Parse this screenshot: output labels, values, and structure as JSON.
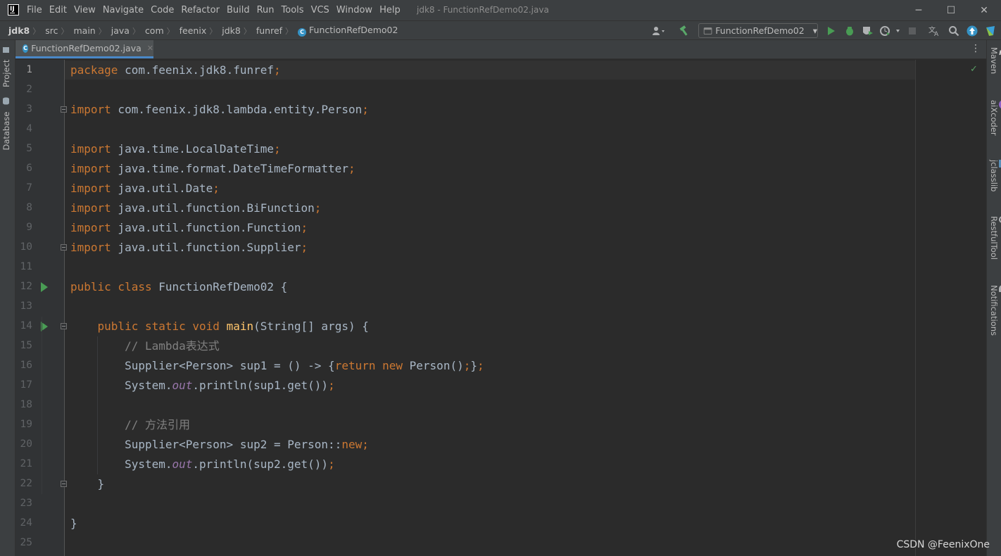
{
  "titlebar": {
    "logo_text": "IJ",
    "menu": [
      "File",
      "Edit",
      "View",
      "Navigate",
      "Code",
      "Refactor",
      "Build",
      "Run",
      "Tools",
      "VCS",
      "Window",
      "Help"
    ],
    "window_title": "jdk8 - FunctionRefDemo02.java",
    "minimize_glyph": "─",
    "maximize_glyph": "☐",
    "close_glyph": "✕"
  },
  "breadcrumb": [
    "jdk8",
    "src",
    "main",
    "java",
    "com",
    "feenix",
    "jdk8",
    "funref",
    "FunctionRefDemo02"
  ],
  "breadcrumb_sep": "〉",
  "toolbar": {
    "run_config": "FunctionRefDemo02",
    "dropdown_glyph": "▾",
    "icons": [
      "user-icon",
      "hammer-icon",
      "run-config-icon",
      "run-icon",
      "debug-icon",
      "coverage-icon",
      "profile-icon",
      "stop-icon",
      "translate-icon",
      "search-icon",
      "update-icon",
      "plugin-icon"
    ]
  },
  "left_tool_windows": [
    "Project",
    "Database"
  ],
  "right_tool_windows": [
    "Maven",
    "aiXcoder",
    "jclasslib",
    "RestfulTool",
    "Notifications"
  ],
  "editor_tab": {
    "label": "FunctionRefDemo02.java",
    "close_glyph": "✕",
    "icon_letter": "C"
  },
  "editor": {
    "line_numbers": [
      "1",
      "2",
      "3",
      "4",
      "5",
      "6",
      "7",
      "8",
      "9",
      "10",
      "11",
      "12",
      "13",
      "14",
      "15",
      "16",
      "17",
      "18",
      "19",
      "20",
      "21",
      "22",
      "23",
      "24",
      "25"
    ],
    "current_line": 1,
    "run_gutter_lines": [
      12,
      14
    ],
    "fold_lines": [
      3,
      10,
      14,
      22
    ],
    "code": [
      [
        [
          "kw",
          "package"
        ],
        [
          "t",
          " com.feenix.jdk8.funref"
        ],
        [
          "kw",
          ";"
        ]
      ],
      [],
      [
        [
          "kw",
          "import"
        ],
        [
          "t",
          " com.feenix.jdk8.lambda.entity.Person"
        ],
        [
          "kw",
          ";"
        ]
      ],
      [],
      [
        [
          "kw",
          "import"
        ],
        [
          "t",
          " java.time.LocalDateTime"
        ],
        [
          "kw",
          ";"
        ]
      ],
      [
        [
          "kw",
          "import"
        ],
        [
          "t",
          " java.time.format.DateTimeFormatter"
        ],
        [
          "kw",
          ";"
        ]
      ],
      [
        [
          "kw",
          "import"
        ],
        [
          "t",
          " java.util.Date"
        ],
        [
          "kw",
          ";"
        ]
      ],
      [
        [
          "kw",
          "import"
        ],
        [
          "t",
          " java.util.function.BiFunction"
        ],
        [
          "kw",
          ";"
        ]
      ],
      [
        [
          "kw",
          "import"
        ],
        [
          "t",
          " java.util.function.Function"
        ],
        [
          "kw",
          ";"
        ]
      ],
      [
        [
          "kw",
          "import"
        ],
        [
          "t",
          " java.util.function.Supplier"
        ],
        [
          "kw",
          ";"
        ]
      ],
      [],
      [
        [
          "kw",
          "public class"
        ],
        [
          "t",
          " FunctionRefDemo02 {"
        ]
      ],
      [],
      [
        [
          "t",
          "    "
        ],
        [
          "kw",
          "public static void"
        ],
        [
          "t",
          " "
        ],
        [
          "fn",
          "main"
        ],
        [
          "t",
          "(String[] args) {"
        ]
      ],
      [
        [
          "t",
          "        "
        ],
        [
          "cmt",
          "// Lambda表达式"
        ]
      ],
      [
        [
          "t",
          "        Supplier<Person> sup1 = () -> {"
        ],
        [
          "kw",
          "return new"
        ],
        [
          "t",
          " Person()"
        ],
        [
          "kw",
          ";"
        ],
        [
          "t",
          "}"
        ],
        [
          "kw",
          ";"
        ]
      ],
      [
        [
          "t",
          "        System."
        ],
        [
          "fld",
          "out"
        ],
        [
          "t",
          ".println(sup1.get())"
        ],
        [
          "kw",
          ";"
        ]
      ],
      [],
      [
        [
          "t",
          "        "
        ],
        [
          "cmt",
          "// 方法引用"
        ]
      ],
      [
        [
          "t",
          "        Supplier<Person> sup2 = Person::"
        ],
        [
          "kw",
          "new"
        ],
        [
          "kw",
          ";"
        ]
      ],
      [
        [
          "t",
          "        System."
        ],
        [
          "fld",
          "out"
        ],
        [
          "t",
          ".println(sup2.get())"
        ],
        [
          "kw",
          ";"
        ]
      ],
      [
        [
          "t",
          "    }"
        ]
      ],
      [],
      [
        [
          "t",
          "}"
        ]
      ],
      []
    ]
  },
  "inspection_status": "✓",
  "tab_menu_glyph": "⋮",
  "watermark": "CSDN @FeenixOne"
}
